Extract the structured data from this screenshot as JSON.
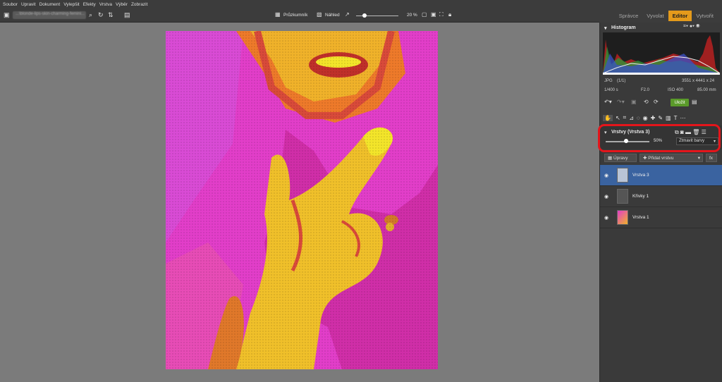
{
  "menu": [
    "Soubor",
    "Upravit",
    "Dokument",
    "Vylepšit",
    "Efekty",
    "Vrstva",
    "Výběr",
    "Zobrazit"
  ],
  "toolbar": {
    "path_text": "...\\blonde-lips-skin-charming-femini...",
    "view_mode": "Průzkumník",
    "preview_label": "Náhled",
    "zoom": "20 %"
  },
  "modes": [
    "Správce",
    "Vyvolat",
    "Editor",
    "Vytvořit"
  ],
  "active_mode": "Editor",
  "histogram": {
    "title": "Histogram",
    "format": "JPG",
    "count": "(1/1)",
    "dimensions": "3551 x 4441 x 24",
    "shutter": "1/400 s",
    "aperture": "F2.0",
    "iso": "ISO 400",
    "focal": "85.00 mm"
  },
  "save_label": "Uložit",
  "layers_panel": {
    "title": "Vrstvy (Vrstva 3)",
    "opacity": "50%",
    "blend_mode": "Ztmavit barvy",
    "adjust_label": "Úpravy",
    "add_layer_label": "Přidat vrstvu",
    "fx_label": "fx"
  },
  "layers": [
    {
      "name": "Vrstva 3",
      "selected": true
    },
    {
      "name": "Křivky 1",
      "selected": false
    },
    {
      "name": "Vrstva 1",
      "selected": false
    }
  ],
  "colors": {
    "accent": "#e49a1b",
    "selection": "#3a63a0",
    "highlight": "#e4151b",
    "save": "#5a9a2a"
  }
}
